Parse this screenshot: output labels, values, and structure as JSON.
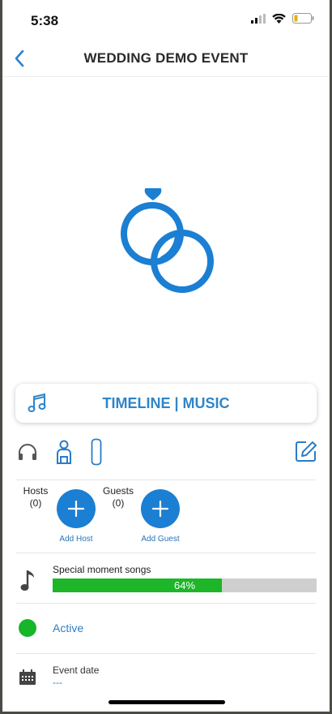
{
  "status_bar": {
    "time": "5:38"
  },
  "nav": {
    "title": "WEDDING DEMO EVENT"
  },
  "timeline": {
    "label": "TIMELINE | MUSIC"
  },
  "people": {
    "hosts_label": "Hosts",
    "hosts_count": "(0)",
    "add_host_label": "Add Host",
    "guests_label": "Guests",
    "guests_count": "(0)",
    "add_guest_label": "Add Guest"
  },
  "songs": {
    "label": "Special moment songs",
    "progress": 0.64,
    "progress_text": "64%"
  },
  "status": {
    "label": "Active",
    "color": "#16b52a"
  },
  "event_date": {
    "label": "Event date",
    "value": "---"
  },
  "colors": {
    "accent": "#1b7fd3",
    "progress_fill": "#1cb628",
    "link": "#2f7fc2"
  },
  "icons": [
    "back-chevron-icon",
    "wedding-rings-icon",
    "music-note-icon",
    "headphones-icon",
    "person-icon",
    "phone-icon",
    "edit-icon",
    "plus-icon",
    "single-note-icon",
    "calendar-icon"
  ]
}
